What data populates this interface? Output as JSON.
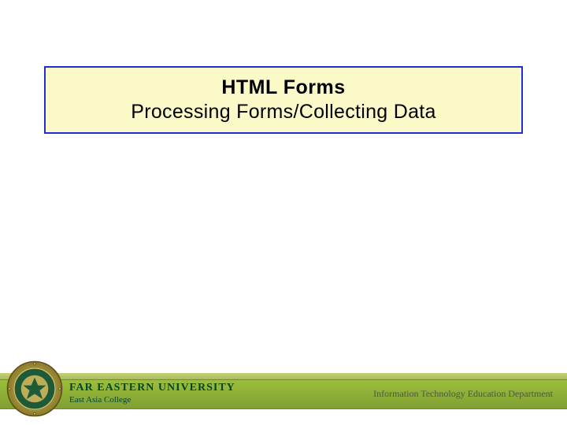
{
  "title": {
    "line1": "HTML  Forms",
    "line2": "Processing Forms/Collecting Data"
  },
  "footer": {
    "university_name": "FAR EASTERN UNIVERSITY",
    "college": "East Asia College",
    "department": "Information Technology Education Department"
  }
}
